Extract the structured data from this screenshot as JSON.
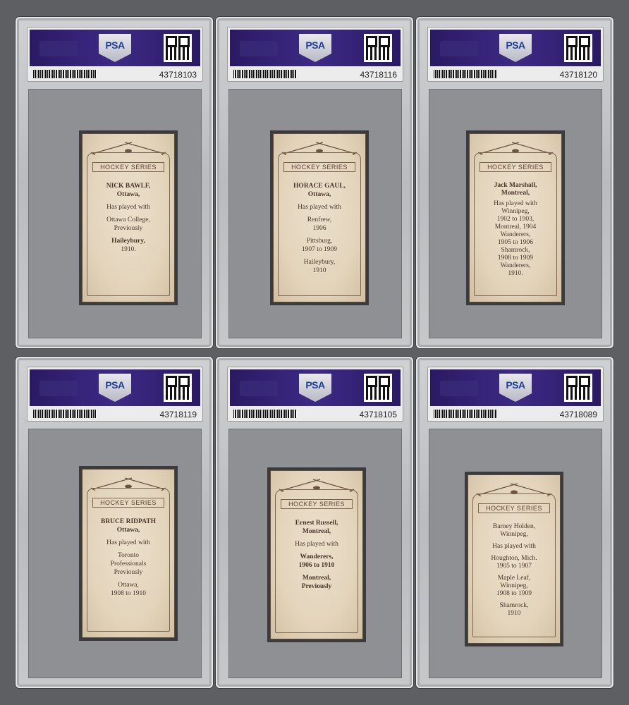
{
  "slabs": [
    {
      "brand": "PSA",
      "cert": "43718103",
      "series": "HOCKEY SERIES",
      "lines": [
        "NICK BAWLF,",
        "Ottawa,",
        "",
        "Has played with",
        "",
        "Ottawa College,",
        "Previously",
        "",
        "Haileybury,",
        "1910."
      ]
    },
    {
      "brand": "PSA",
      "cert": "43718116",
      "series": "HOCKEY SERIES",
      "lines": [
        "HORACE GAUL,",
        "Ottawa,",
        "",
        "Has played with",
        "",
        "Renfrew,",
        "1906",
        "",
        "Pittsburg,",
        "1907 to 1909",
        "",
        "Haileybury,",
        "1910"
      ]
    },
    {
      "brand": "PSA",
      "cert": "43718120",
      "series": "HOCKEY SERIES",
      "lines": [
        "Jack Marshall,",
        "Montreal,",
        "",
        "Has played with",
        "Winnipeg,",
        "1902 to 1903,",
        "Montreal, 1904",
        "Wanderers,",
        "1905 to 1906",
        "Shamrock,",
        "1908 to 1909",
        "Wanderers,",
        "1910."
      ]
    },
    {
      "brand": "PSA",
      "cert": "43718119",
      "series": "HOCKEY SERIES",
      "lines": [
        "BRUCE RIDPATH",
        "Ottawa,",
        "",
        "Has played with",
        "",
        "Toronto",
        "Professionals",
        "Previously",
        "",
        "Ottawa,",
        "1908 to 1910"
      ]
    },
    {
      "brand": "PSA",
      "cert": "43718105",
      "series": "HOCKEY SERIES",
      "lines": [
        "Ernest Russell,",
        "Montreal,",
        "",
        "Has played with",
        "",
        "Wanderers,",
        "1906 to 1910",
        "",
        "Montreal,",
        "Previously"
      ]
    },
    {
      "brand": "PSA",
      "cert": "43718089",
      "series": "HOCKEY SERIES",
      "lines": [
        "Barney Holden,",
        "Winnipeg,",
        "",
        "Has played with",
        "",
        "Houghton, Mich.",
        "1905 to 1907",
        "",
        "Maple Leaf,",
        "Winnipeg,",
        "1908 to 1909",
        "",
        "Shamrock,",
        "1910"
      ]
    }
  ]
}
